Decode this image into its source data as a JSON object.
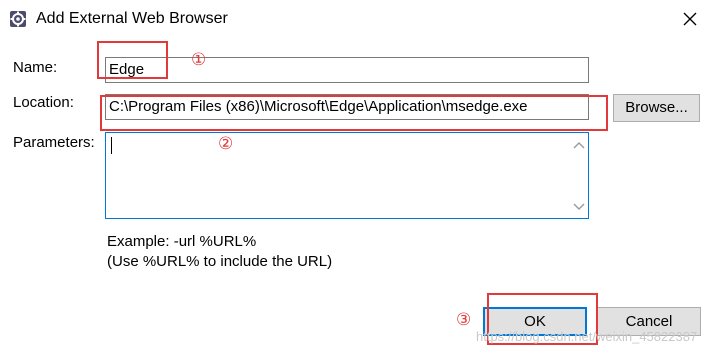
{
  "window": {
    "title": "Add External Web Browser"
  },
  "form": {
    "name_label": "Name:",
    "name_value": "Edge",
    "location_label": "Location:",
    "location_value": "C:\\Program Files (x86)\\Microsoft\\Edge\\Application\\msedge.exe",
    "browse_label": "Browse...",
    "parameters_label": "Parameters:",
    "parameters_value": "",
    "example_line1": "Example: -url %URL%",
    "example_line2": "(Use %URL% to include the URL)"
  },
  "buttons": {
    "ok_label": "OK",
    "cancel_label": "Cancel"
  },
  "annotations": {
    "step1": "①",
    "step2": "②",
    "step3": "③",
    "color": "#e23a3a"
  },
  "watermark": {
    "text": "https://blog.csdn.net/weixin_45822387"
  },
  "icons": {
    "app": "eclipse-gear-icon",
    "close": "close-icon",
    "scroll_up": "chevron-up-icon",
    "scroll_down": "chevron-down-icon"
  }
}
